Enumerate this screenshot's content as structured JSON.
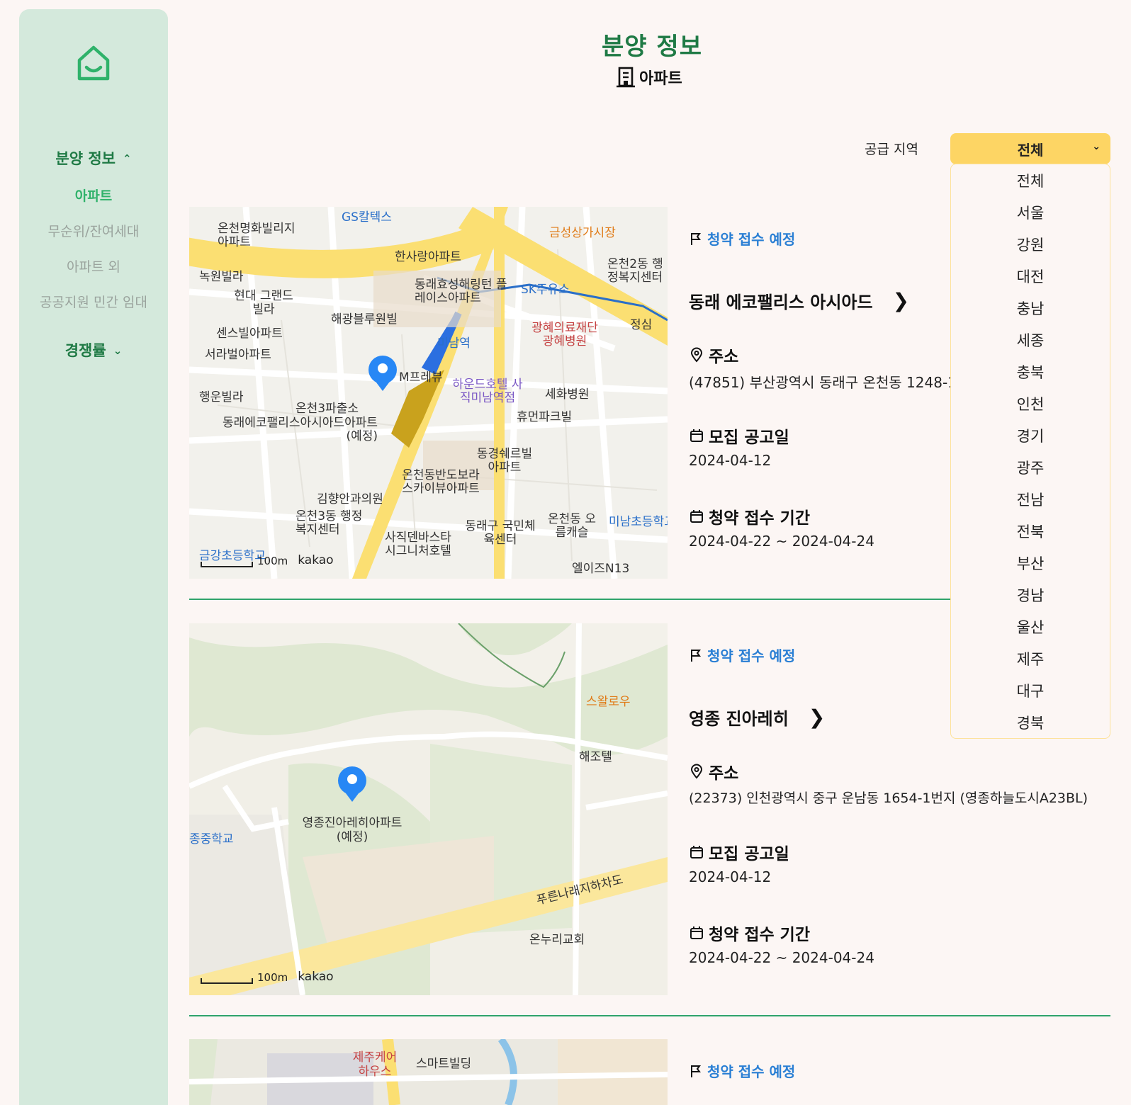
{
  "sidebar": {
    "sections": [
      {
        "label": "분양 정보",
        "chevron": "chevron-up-icon",
        "items": [
          {
            "label": "아파트",
            "active": true
          },
          {
            "label": "무순위/잔여세대",
            "active": false
          },
          {
            "label": "아파트 외",
            "active": false
          },
          {
            "label": "공공지원 민간 임대",
            "active": false
          }
        ]
      },
      {
        "label": "경쟁률",
        "chevron": "chevron-down-icon",
        "items": []
      }
    ]
  },
  "header": {
    "title": "분양 정보",
    "subtitle": "아파트"
  },
  "filter": {
    "label": "공급 지역",
    "selected": "전체",
    "options": [
      "전체",
      "서울",
      "강원",
      "대전",
      "충남",
      "세종",
      "충북",
      "인천",
      "경기",
      "광주",
      "전남",
      "전북",
      "부산",
      "경남",
      "울산",
      "제주",
      "대구",
      "경북"
    ]
  },
  "colors": {
    "primary_green": "#1f7a45",
    "sidebar_bg": "#d4e9dc",
    "select_yellow": "#fdd564",
    "status_blue": "#2a7fd4"
  },
  "listings": [
    {
      "status": "청약 접수 예정",
      "name": "동래 에코팰리스 아시아드",
      "address_label": "주소",
      "address": "(47851) 부산광역시 동래구 온천동 1248-1",
      "notice_label": "모집 공고일",
      "notice_date": "2024-04-12",
      "period_label": "청약 접수 기간",
      "period": "2024-04-22 ~ 2024-04-24",
      "map": {
        "labels": [
          "GS칼텍스",
          "금성상가시장",
          "온천명화빌리지 아파트",
          "한사랑아파트",
          "녹원빌라",
          "현대 그랜드빌라",
          "동래효성해링턴 플레이스아파트",
          "SK주유소",
          "온천2동 행정복지센터",
          "해광블루원빌",
          "센스빌아파트",
          "광혜의료재단 광혜병원",
          "정심",
          "미남역",
          "서라벌아파트",
          "M프레뷰",
          "하운드호텔 사직미남역점",
          "세화병원",
          "행운빌라",
          "온천3파출소",
          "휴먼파크빌",
          "동래에코팰리스아시아드아파트 (예정)",
          "동경쉐르빌 아파트",
          "온천동반도보라 스카이뷰아파트",
          "김향안과의원",
          "온천3동 행정복지센터",
          "사직덴바스타 시그니처호텔",
          "동래구 국민체육센터",
          "온천동 오름캐슬",
          "미남초등학교",
          "금강초등학교",
          "엘이즈N13"
        ],
        "scale": "100m",
        "brand": "kakao"
      }
    },
    {
      "status": "청약 접수 예정",
      "name": "영종 진아레히",
      "address_label": "주소",
      "address": "(22373) 인천광역시 중구 운남동 1654-1번지 (영종하늘도시A23BL)",
      "notice_label": "모집 공고일",
      "notice_date": "2024-04-12",
      "period_label": "청약 접수 기간",
      "period": "2024-04-22 ~ 2024-04-24",
      "map": {
        "labels": [
          "스왈로우",
          "해조텔",
          "영종진아레히아파트 (예정)",
          "종중학교",
          "푸른나래지하차도",
          "온누리교회"
        ],
        "scale": "100m",
        "brand": "kakao"
      }
    },
    {
      "status": "청약 접수 예정",
      "map": {
        "labels": [
          "제주케어 하우스",
          "스마트빌딩"
        ]
      }
    }
  ]
}
